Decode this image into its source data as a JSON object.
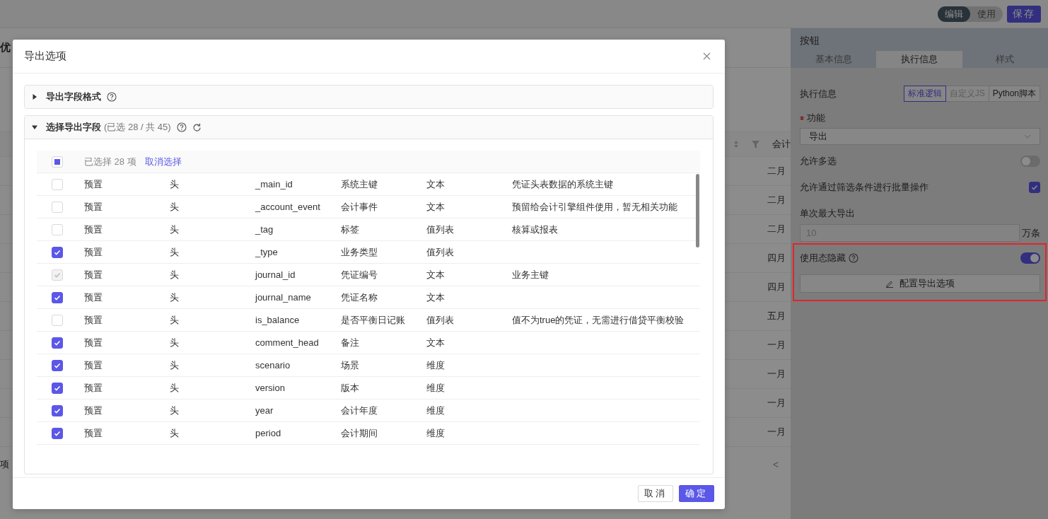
{
  "top_bar": {
    "mode_toggle": [
      {
        "label": "编辑",
        "selected": true
      },
      {
        "label": "使用",
        "selected": false
      }
    ],
    "save_button": "保存"
  },
  "background": {
    "page_title": "优",
    "table_header": "会计",
    "months": [
      "二月",
      "二月",
      "二月",
      "四月",
      "四月",
      "五月",
      "一月",
      "一月",
      "一月",
      "一月"
    ],
    "footer_text": "项",
    "pagination_prev": "<"
  },
  "right_panel": {
    "title": "按钮",
    "tabs": [
      {
        "label": "基本信息",
        "selected": false
      },
      {
        "label": "执行信息",
        "selected": true
      },
      {
        "label": "样式",
        "selected": false
      }
    ],
    "execution": {
      "label": "执行信息",
      "options": [
        {
          "label": "标准逻辑",
          "selected": true,
          "disabled": false
        },
        {
          "label": "自定义JS",
          "selected": false,
          "disabled": true
        },
        {
          "label": "Python脚本",
          "selected": false,
          "disabled": false
        }
      ]
    },
    "function": {
      "label": "功能",
      "required": true,
      "value": "导出"
    },
    "multi_select": {
      "label": "允许多选",
      "on": false
    },
    "batch_filter": {
      "label": "允许通过筛选条件进行批量操作",
      "checked": true
    },
    "max_export": {
      "label": "单次最大导出",
      "placeholder": "10",
      "unit": "万条"
    },
    "hidden_in_use": {
      "label": "使用态隐藏",
      "on": true,
      "highlighted": true
    },
    "config_button": "配置导出选项"
  },
  "dialog": {
    "title": "导出选项",
    "sections": [
      {
        "title": "导出字段格式",
        "expanded": false
      },
      {
        "title": "选择导出字段",
        "count": "(已选 28 / 共 45)",
        "expanded": true
      }
    ],
    "selection": {
      "indeterminate": true,
      "summary": "已选择 28 项",
      "clear_link": "取消选择"
    },
    "rows": [
      {
        "checked": false,
        "disabled": false,
        "cells": [
          "预置",
          "头",
          "_main_id",
          "系统主键",
          "文本",
          "凭证头表数据的系统主键"
        ]
      },
      {
        "checked": false,
        "disabled": false,
        "cells": [
          "预置",
          "头",
          "_account_event",
          "会计事件",
          "文本",
          "预留给会计引擎组件使用，暂无相关功能"
        ]
      },
      {
        "checked": false,
        "disabled": false,
        "cells": [
          "预置",
          "头",
          "_tag",
          "标签",
          "值列表",
          "核算或报表"
        ]
      },
      {
        "checked": true,
        "disabled": false,
        "cells": [
          "预置",
          "头",
          "_type",
          "业务类型",
          "值列表"
        ]
      },
      {
        "checked": true,
        "disabled": true,
        "cells": [
          "预置",
          "头",
          "journal_id",
          "凭证编号",
          "文本",
          "业务主键"
        ]
      },
      {
        "checked": true,
        "disabled": false,
        "cells": [
          "预置",
          "头",
          "journal_name",
          "凭证名称",
          "文本"
        ]
      },
      {
        "checked": false,
        "disabled": false,
        "cells": [
          "预置",
          "头",
          "is_balance",
          "是否平衡日记账",
          "值列表",
          "值不为true的凭证，无需进行借贷平衡校验"
        ]
      },
      {
        "checked": true,
        "disabled": false,
        "cells": [
          "预置",
          "头",
          "comment_head",
          "备注",
          "文本"
        ]
      },
      {
        "checked": true,
        "disabled": false,
        "cells": [
          "预置",
          "头",
          "scenario",
          "场景",
          "维度"
        ]
      },
      {
        "checked": true,
        "disabled": false,
        "cells": [
          "预置",
          "头",
          "version",
          "版本",
          "维度"
        ]
      },
      {
        "checked": true,
        "disabled": false,
        "cells": [
          "预置",
          "头",
          "year",
          "会计年度",
          "维度"
        ]
      },
      {
        "checked": true,
        "disabled": false,
        "cells": [
          "预置",
          "头",
          "period",
          "会计期间",
          "维度"
        ]
      }
    ],
    "buttons": [
      {
        "label": "取消",
        "kind": "secondary"
      },
      {
        "label": "确定",
        "kind": "primary"
      }
    ]
  }
}
